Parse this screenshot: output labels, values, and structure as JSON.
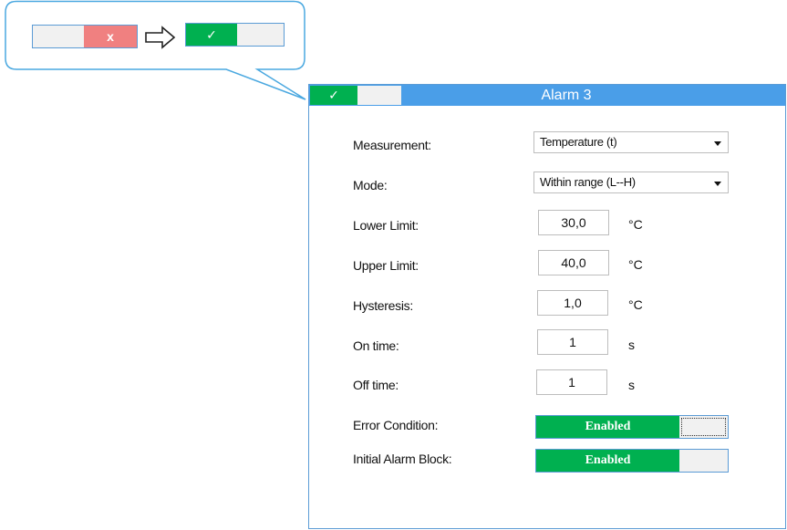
{
  "callout": {
    "before_toggle": {
      "state": "off",
      "mark": "x"
    },
    "after_toggle": {
      "state": "on",
      "mark": "✓"
    },
    "arrow": "right-arrow-icon"
  },
  "panel": {
    "title": "Alarm 3",
    "header_toggle_mark": "✓",
    "fields": {
      "measurement": {
        "label": "Measurement:",
        "value": "Temperature (t)"
      },
      "mode": {
        "label": "Mode:",
        "value": "Within range (L--H)"
      },
      "lower_limit": {
        "label": "Lower Limit:",
        "value": "30,0",
        "unit": "°C"
      },
      "upper_limit": {
        "label": "Upper Limit:",
        "value": "40,0",
        "unit": "°C"
      },
      "hysteresis": {
        "label": "Hysteresis:",
        "value": "1,0",
        "unit": "°C"
      },
      "on_time": {
        "label": "On time:",
        "value": "1",
        "unit": "s"
      },
      "off_time": {
        "label": "Off time:",
        "value": "1",
        "unit": "s"
      },
      "error_condition": {
        "label": "Error Condition:",
        "value": "Enabled"
      },
      "initial_alarm_block": {
        "label": "Initial Alarm Block:",
        "value": "Enabled"
      }
    }
  },
  "colors": {
    "accent": "#4a9ee8",
    "enabled_green": "#00b050",
    "disabled_red": "#f08080",
    "border": "#5b9bd5"
  }
}
